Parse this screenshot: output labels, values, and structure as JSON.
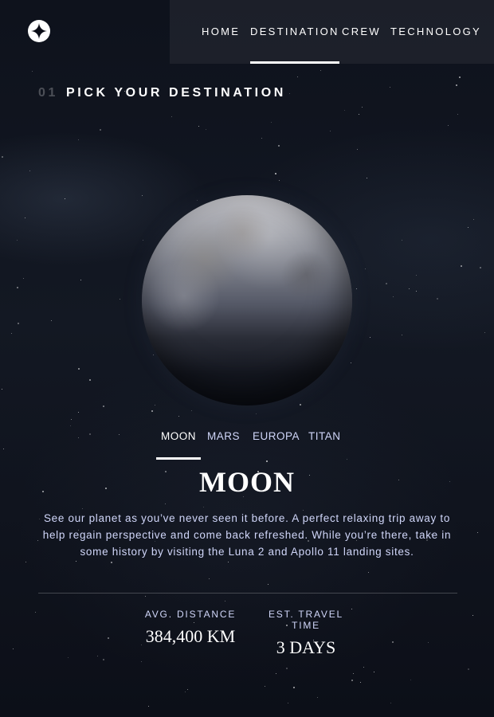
{
  "nav": {
    "items": [
      {
        "label": "HOME"
      },
      {
        "label": "DESTINATION"
      },
      {
        "label": "CREW"
      },
      {
        "label": "TECHNOLOGY"
      }
    ],
    "active": "DESTINATION"
  },
  "page": {
    "number": "01",
    "subheading": "PICK YOUR DESTINATION"
  },
  "tabs": {
    "items": [
      {
        "label": "MOON"
      },
      {
        "label": "MARS"
      },
      {
        "label": "EUROPA"
      },
      {
        "label": "TITAN"
      }
    ],
    "active": "MOON"
  },
  "destination": {
    "name": "MOON",
    "description": "See our planet as you’ve never seen it before. A perfect relaxing trip away to help regain perspective and come back refreshed. While you’re there, take in some history by visiting the Luna 2 and Apollo 11 landing sites.",
    "stats": {
      "distance_label": "AVG. DISTANCE",
      "distance_value": "384,400 KM",
      "travel_label": "EST. TRAVEL TIME",
      "travel_value": "3 DAYS"
    }
  },
  "colors": {
    "background": "#0b0d17",
    "accent_text": "#d0d6f9",
    "white": "#ffffff"
  },
  "icons": {
    "logo": "star-logo-icon"
  }
}
